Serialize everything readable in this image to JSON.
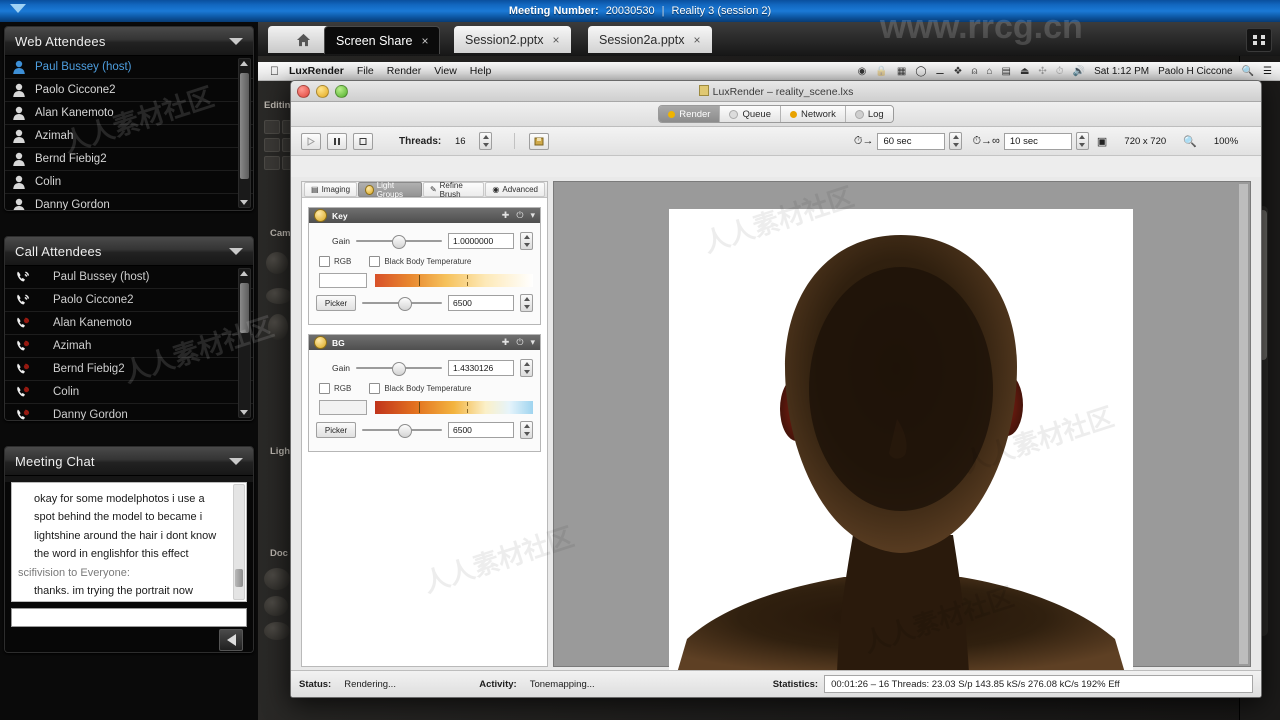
{
  "topbar": {
    "meeting_number_label": "Meeting Number:",
    "meeting_number": "20030530",
    "separator": "|",
    "session_title": "Reality 3 (session 2)",
    "collapse_icon": "caret-down-icon"
  },
  "tabbar": {
    "home_icon": "home-icon",
    "expand_icon": "fullscreen-icon",
    "tabs": [
      {
        "label": "Screen Share",
        "close": "×",
        "active": true
      },
      {
        "label": "Session2.pptx",
        "close": "×",
        "active": false
      },
      {
        "label": "Session2a.pptx",
        "close": "×",
        "active": false
      }
    ]
  },
  "web_attendees": {
    "title": "Web Attendees",
    "collapse_icon": "caret-down-icon",
    "items": [
      {
        "name": "Paul Bussey (host)",
        "icon": "person-icon",
        "host": true
      },
      {
        "name": "Paolo Ciccone2",
        "icon": "person-icon",
        "host": false
      },
      {
        "name": "Alan Kanemoto",
        "icon": "person-icon",
        "host": false
      },
      {
        "name": "Azimah",
        "icon": "person-icon",
        "host": false
      },
      {
        "name": "Bernd Fiebig2",
        "icon": "person-icon",
        "host": false
      },
      {
        "name": "Colin",
        "icon": "person-icon",
        "host": false
      },
      {
        "name": "Danny Gordon",
        "icon": "person-icon",
        "host": false
      }
    ]
  },
  "call_attendees": {
    "title": "Call Attendees",
    "collapse_icon": "caret-down-icon",
    "items": [
      {
        "name": "Paul Bussey (host)",
        "icon": "phone-active-icon",
        "talking": true
      },
      {
        "name": "Paolo Ciccone2",
        "icon": "phone-active-icon",
        "talking": true
      },
      {
        "name": "Alan Kanemoto",
        "icon": "phone-muted-icon",
        "talking": false
      },
      {
        "name": "Azimah",
        "icon": "phone-muted-icon",
        "talking": false
      },
      {
        "name": "Bernd Fiebig2",
        "icon": "phone-muted-icon",
        "talking": false
      },
      {
        "name": "Colin",
        "icon": "phone-muted-icon",
        "talking": false
      },
      {
        "name": "Danny Gordon",
        "icon": "phone-muted-icon",
        "talking": false
      }
    ]
  },
  "meeting_chat": {
    "title": "Meeting Chat",
    "collapse_icon": "caret-down-icon",
    "lines": [
      {
        "text": "okay for some modelphotos i use a",
        "kind": "msg"
      },
      {
        "text": "spot behind the model to became i",
        "kind": "msg"
      },
      {
        "text": "lightshine around the hair i dont know",
        "kind": "msg"
      },
      {
        "text": "the word in englishfor this effect",
        "kind": "msg"
      },
      {
        "text": "scifivision to Everyone:",
        "kind": "from"
      },
      {
        "text": "thanks. im trying the portrait now",
        "kind": "msg"
      }
    ],
    "input_value": "",
    "input_placeholder": "",
    "send_icon": "send-arrow-icon"
  },
  "mac_menu": {
    "apple_icon": "apple-icon",
    "app_name": "LuxRender",
    "items": [
      "File",
      "Render",
      "View",
      "Help"
    ],
    "status_icons": [
      "timemachine-icon",
      "lock-icon",
      "keyboard-icon",
      "clock-icon",
      "eyedropper-icon",
      "dropbox-icon",
      "flux-icon",
      "home-icon",
      "battery-icon",
      "eject-icon",
      "bluetooth-icon",
      "timemachine2-icon",
      "volume-icon"
    ],
    "clock": "Sat 1:12 PM",
    "user": "Paolo H Ciccone",
    "search_icon": "search-icon",
    "notifications_icon": "list-icon"
  },
  "lux_window": {
    "title": "LuxRender – reality_scene.lxs",
    "doc_icon": "document-icon",
    "traffic_lights": [
      "close-icon",
      "minimize-icon",
      "zoom-icon"
    ],
    "main_tabs": [
      {
        "label": "Render",
        "icon": "render-icon",
        "active": true
      },
      {
        "label": "Queue",
        "icon": "queue-icon",
        "active": false
      },
      {
        "label": "Network",
        "icon": "network-icon",
        "active": false
      },
      {
        "label": "Log",
        "icon": "log-icon",
        "active": false
      }
    ],
    "toolbar": {
      "play_icon": "play-icon",
      "pause_icon": "pause-icon",
      "stop_icon": "stop-icon",
      "threads_label": "Threads:",
      "threads_value": "16",
      "save_icon": "save-image-icon",
      "write_interval_icon": "write-interval-icon",
      "write_interval_value": "60 sec",
      "refresh_interval_icon": "refresh-interval-icon",
      "refresh_interval_value": "10 sec",
      "resolution_icon": "resolution-icon",
      "resolution_value": "720 x 720",
      "zoom_icon": "magnifier-icon",
      "zoom_value": "100%"
    },
    "panel_tabs": [
      {
        "label": "Imaging",
        "icon": "imaging-icon",
        "active": false
      },
      {
        "label": "Light Groups",
        "icon": "lightbulb-icon",
        "active": true
      },
      {
        "label": "Refine Brush",
        "icon": "brush-icon",
        "active": false
      },
      {
        "label": "Advanced",
        "icon": "gear-icon",
        "active": false
      }
    ],
    "light_groups": [
      {
        "name": "Key",
        "icon": "lightbulb-icon",
        "actions": [
          "add-icon",
          "power-icon",
          "menu-icon"
        ],
        "gain_label": "Gain",
        "gain_value": "1.0000000",
        "gain_pos": 0.49,
        "rgb_label": "RGB",
        "rgb_checked": false,
        "bbt_label": "Black Body Temperature",
        "bbt_checked": false,
        "picker_label": "Picker",
        "temp_value": "6500",
        "temp_pos": 0.53,
        "swatch_color": "#ffffff"
      },
      {
        "name": "BG",
        "icon": "lightbulb-icon",
        "actions": [
          "add-icon",
          "power-icon",
          "menu-icon"
        ],
        "gain_label": "Gain",
        "gain_value": "1.4330126",
        "gain_pos": 0.49,
        "rgb_label": "RGB",
        "rgb_checked": false,
        "bbt_label": "Black Body Temperature",
        "bbt_checked": false,
        "picker_label": "Picker",
        "temp_value": "6500",
        "temp_pos": 0.53,
        "swatch_color": "#f2f2f2"
      }
    ],
    "status_bar": {
      "status_label": "Status:",
      "status_value": "Rendering...",
      "activity_label": "Activity:",
      "activity_value": "Tonemapping...",
      "statistics_label": "Statistics:",
      "statistics_value": "00:01:26 – 16 Threads: 23.03 S/p  143.85 kS/s  276.08 kC/s  192% Eff"
    }
  },
  "background_app": {
    "labels": [
      "Editing",
      "Came",
      "Light",
      "Doc"
    ]
  },
  "watermarks": {
    "url": "www.rrcg.cn",
    "text": "人人素材社区"
  },
  "colors": {
    "accent_blue": "#1b7ad6",
    "host_blue": "#4e9fe0",
    "panel_dark": "#151515",
    "lux_chrome": "#ededed",
    "render_bg": "#9a9a9a"
  }
}
